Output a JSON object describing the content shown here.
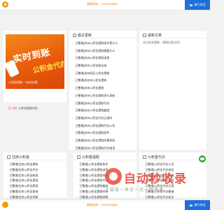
{
  "topbar": {
    "hotline": "客服热线：13419966881",
    "button": "拨打电话"
  },
  "bottombar": {
    "hotline": "客服热线：13419966881",
    "button": "拨打电话"
  },
  "feature": {
    "banner_title": "实时到账",
    "banner_badge": "公积金代办",
    "banner_sub": "公积金提取·一站式办理",
    "caption_tag": "【广州】",
    "caption_text": "公积金提取代办"
  },
  "recent": {
    "header": "最近更新",
    "items": [
      "已整理|苏州公积金提取条件是什么",
      "已整理|苏州公积金提取需要什么",
      "已整理|苏州公积金提取流程",
      "已整理|苏州公积金取出来",
      "已整理|苏州园区公积金提取",
      "已整理|苏州市公积金提取",
      "已整理|苏州公积金提取",
      "已整理|苏州公积金提取多久到账",
      "已整理|苏州公积金提取代办",
      "已整理|苏州公积金提取额度",
      "已整理|苏州公积金代办正规吗",
      "已整理|苏州公积金提取代办公司",
      "已整理|苏州公积金提取条件",
      "已整理|苏州公积金提取所需资料",
      "已整理|苏州公积金提取代办电话",
      "已整理|苏州公积金代取最新政策",
      "已整理|苏州住房公积金提取"
    ]
  },
  "latest": {
    "header": "最新文章",
    "text": "本月还未更新，请稍后再访问！"
  },
  "sections": [
    {
      "header": "住房公积金",
      "items": [
        "已整理|住房公积金提取",
        "已整理|住房公积金代办",
        "已整理|住房公积金取现",
        "已整理|住房公积金提现",
        "已整理|住房公积金套现",
        "已整理|住房公积金查询",
        "已整理|住房公积金余额"
      ]
    },
    {
      "header": "公积金提取",
      "items": [
        "已整理|公积金提取条件",
        "已整理|公积金提取流程",
        "已整理|公积金提取材料",
        "已整理|公积金提取代办",
        "已整理|公积金提取额度",
        "已整理|公积金提取时间",
        "已整理|公积金提取政策"
      ]
    },
    {
      "header": "公积金代办",
      "items": [
        "已整理|公积金代办公司",
        "已整理|公积金代办电话",
        "已整理|公积金代办费用",
        "已整理|公积金代办流程",
        "已整理|公积金代办正规",
        "已整理|公积金代办靠谱",
        "已整理|公积金代办安全"
      ]
    }
  ],
  "watermark": {
    "title": "自动秒收录",
    "sub": "让链接一来访一次一秒收录"
  }
}
